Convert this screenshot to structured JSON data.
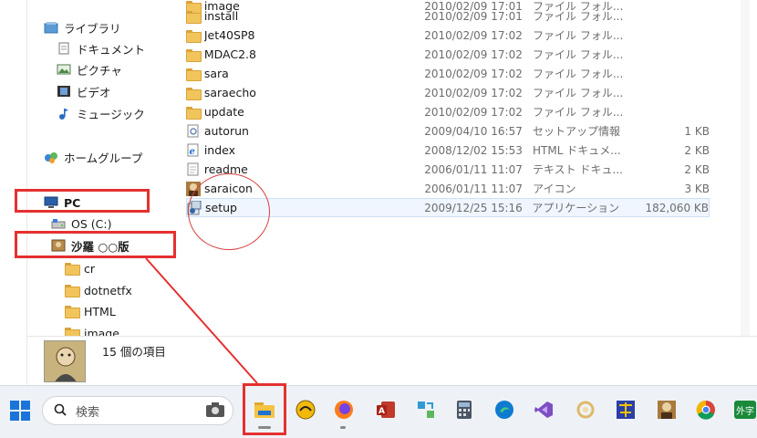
{
  "nav": {
    "items": [
      {
        "label": "ライブラリ",
        "icon": "library-icon",
        "indent": 0
      },
      {
        "label": "ドキュメント",
        "icon": "documents-icon",
        "indent": 1
      },
      {
        "label": "ピクチャ",
        "icon": "pictures-icon",
        "indent": 1
      },
      {
        "label": "ビデオ",
        "icon": "videos-icon",
        "indent": 1
      },
      {
        "label": "ミュージック",
        "icon": "music-icon",
        "indent": 1
      },
      {
        "label": "ホームグループ",
        "icon": "homegroup-icon",
        "indent": 0
      },
      {
        "label": "PC",
        "icon": "pc-icon",
        "indent": 0
      },
      {
        "label": "OS (C:)",
        "icon": "drive-icon",
        "indent": 1
      },
      {
        "label": "沙羅 ○○版",
        "icon": "sara-drive-icon",
        "indent": 1
      },
      {
        "label": "cr",
        "icon": "folder-icon",
        "indent": 2
      },
      {
        "label": "dotnetfx",
        "icon": "folder-icon",
        "indent": 2
      },
      {
        "label": "HTML",
        "icon": "folder-icon",
        "indent": 2
      },
      {
        "label": "image",
        "icon": "folder-icon",
        "indent": 2
      }
    ]
  },
  "files": [
    {
      "name": "image",
      "date": "2010/02/09 17:01",
      "type": "ファイル フォル...",
      "size": "",
      "icon": "folder-icon"
    },
    {
      "name": "install",
      "date": "2010/02/09 17:01",
      "type": "ファイル フォル...",
      "size": "",
      "icon": "folder-icon"
    },
    {
      "name": "Jet40SP8",
      "date": "2010/02/09 17:02",
      "type": "ファイル フォル...",
      "size": "",
      "icon": "folder-icon"
    },
    {
      "name": "MDAC2.8",
      "date": "2010/02/09 17:02",
      "type": "ファイル フォル...",
      "size": "",
      "icon": "folder-icon"
    },
    {
      "name": "sara",
      "date": "2010/02/09 17:02",
      "type": "ファイル フォル...",
      "size": "",
      "icon": "folder-icon"
    },
    {
      "name": "saraecho",
      "date": "2010/02/09 17:02",
      "type": "ファイル フォル...",
      "size": "",
      "icon": "folder-icon"
    },
    {
      "name": "update",
      "date": "2010/02/09 17:02",
      "type": "ファイル フォル...",
      "size": "",
      "icon": "folder-icon"
    },
    {
      "name": "autorun",
      "date": "2009/04/10 16:57",
      "type": "セットアップ情報",
      "size": "1 KB",
      "icon": "setup-info-icon"
    },
    {
      "name": "index",
      "date": "2008/12/02 15:53",
      "type": "HTML ドキュメ...",
      "size": "2 KB",
      "icon": "html-doc-icon"
    },
    {
      "name": "readme",
      "date": "2006/01/11 11:07",
      "type": "テキスト ドキュ...",
      "size": "2 KB",
      "icon": "text-doc-icon"
    },
    {
      "name": "saraicon",
      "date": "2006/01/11 11:07",
      "type": "アイコン",
      "size": "3 KB",
      "icon": "sara-icon-file-icon"
    },
    {
      "name": "setup",
      "date": "2009/12/25 15:16",
      "type": "アプリケーション",
      "size": "182,060 KB",
      "icon": "setup-app-icon"
    }
  ],
  "details": {
    "count_text": "15 個の項目"
  },
  "taskbar": {
    "search_placeholder": "検索",
    "apps": [
      "camera-app-icon",
      "file-explorer-icon",
      "winamp-icon",
      "firefox-icon",
      "access-icon",
      "shortcut-tool-icon",
      "calculator-icon",
      "edge-icon",
      "visual-studio-icon",
      "ring-app-icon",
      "game-app-icon",
      "sara-app-icon",
      "chrome-icon",
      "gaishi-app-icon"
    ],
    "gaishi_label": "外字"
  },
  "colors": {
    "annotation_red": "#e53030",
    "folder_yellow": "#f2c55c",
    "accent_blue": "#0067c0"
  }
}
